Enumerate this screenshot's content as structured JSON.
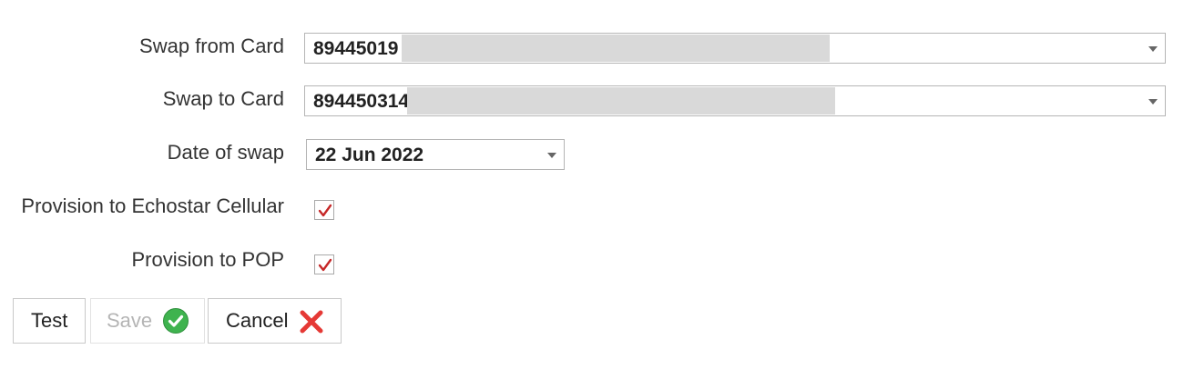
{
  "form": {
    "swap_from": {
      "label": "Swap from Card",
      "value": "89445019"
    },
    "swap_to": {
      "label": "Swap to Card",
      "value": "894450314"
    },
    "date": {
      "label": "Date of swap",
      "value": "22 Jun 2022"
    },
    "provision_echostar": {
      "label": "Provision to Echostar Cellular",
      "checked": true
    },
    "provision_pop": {
      "label": "Provision to POP",
      "checked": true
    }
  },
  "buttons": {
    "test": "Test",
    "save": "Save",
    "cancel": "Cancel"
  },
  "colors": {
    "check": "#c62828",
    "save_icon": "#3fb34f",
    "cancel_icon": "#e53935",
    "redaction": "#d9d9d9"
  },
  "icons": {
    "save": "check-circle-icon",
    "cancel": "x-icon"
  }
}
